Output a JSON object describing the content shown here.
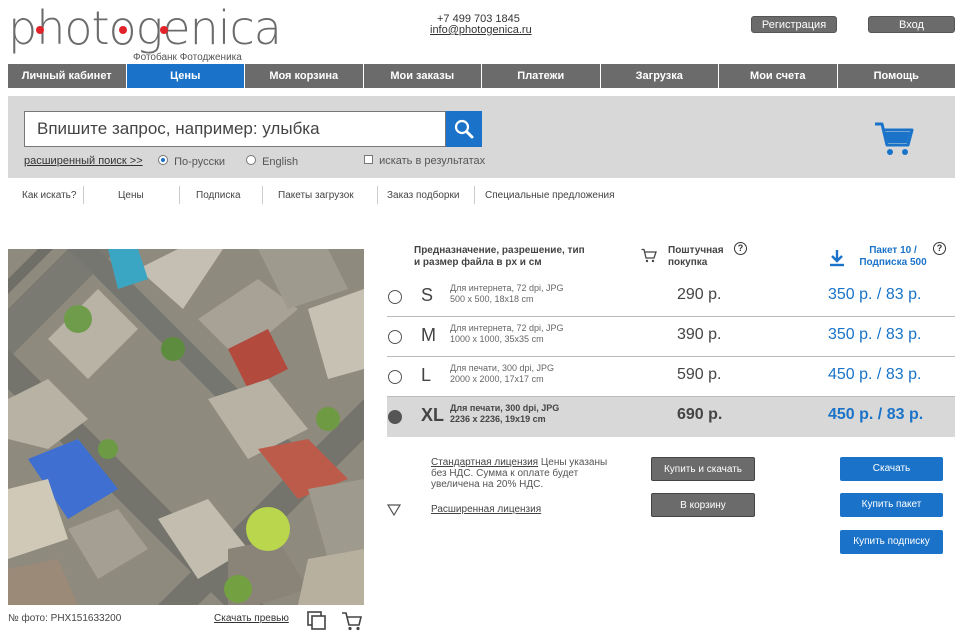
{
  "header": {
    "logo": "photogenica",
    "logo_sub": "Фотобанк Фотодженика",
    "phone": "+7 499 703 1845",
    "email": "info@photogenica.ru",
    "register_label": "Регистрация",
    "login_label": "Вход"
  },
  "nav": {
    "items": [
      "Личный кабинет",
      "Цены",
      "Моя корзина",
      "Мои заказы",
      "Платежи",
      "Загрузка",
      "Мои счета",
      "Помощь"
    ],
    "active_index": 1
  },
  "search": {
    "placeholder": "Впишите запрос, например: улыбка",
    "advanced_link": "расширенный поиск >>",
    "lang_ru": "По-русски",
    "lang_en": "English",
    "lang_selected": "По-русски",
    "in_results": "искать в результатах"
  },
  "subnav": {
    "items": [
      "Как искать?",
      "Цены",
      "Подписка",
      "Пакеты загрузок",
      "Заказ подборки",
      "Специальные предложения"
    ]
  },
  "photo": {
    "id_text": "№ фото: PHX151633200",
    "preview_link": "Скачать превью"
  },
  "pricing": {
    "header_purpose": "Предназначение, разрешение, тип и размер файла в px и см",
    "header_single_line1": "Поштучная",
    "header_single_line2": "покупка",
    "header_pack_line1": "Пакет 10 /",
    "header_pack_line2": "Подписка 500",
    "help_glyph": "?",
    "rows": [
      {
        "size": "S",
        "line1": "Для интернета, 72 dpi, JPG",
        "line2": "500 x 500, 18x18 cm",
        "price": "290 р.",
        "pack": "350 р. / 83 р.",
        "selected": false
      },
      {
        "size": "M",
        "line1": "Для интернета, 72 dpi, JPG",
        "line2": "1000 x 1000, 35x35 cm",
        "price": "390 р.",
        "pack": "350 р. / 83 р.",
        "selected": false
      },
      {
        "size": "L",
        "line1": "Для печати, 300 dpi, JPG",
        "line2": "2000 x 2000, 17x17 cm",
        "price": "590 р.",
        "pack": "450 р. / 83 р.",
        "selected": false
      },
      {
        "size": "XL",
        "line1": "Для печати, 300 dpi, JPG",
        "line2": "2236 x 2236, 19x19 cm",
        "price": "690 р.",
        "pack": "450 р. / 83 р.",
        "selected": true
      }
    ],
    "std_license_link": "Стандартная лицензия",
    "std_license_text": " Цены указаны без НДС. Сумма к оплате будет увеличена на 20% НДС.",
    "ext_license_link": "Расширенная лицензия",
    "buy_download_label": "Купить и скачать",
    "to_cart_label": "В корзину",
    "download_label": "Скачать",
    "buy_pack_label": "Купить пакет",
    "buy_subscription_label": "Купить подписку"
  },
  "colors": {
    "accent": "#1a73c9",
    "gray_button": "#6b6b6b",
    "logo_dot": "#e2222a"
  }
}
